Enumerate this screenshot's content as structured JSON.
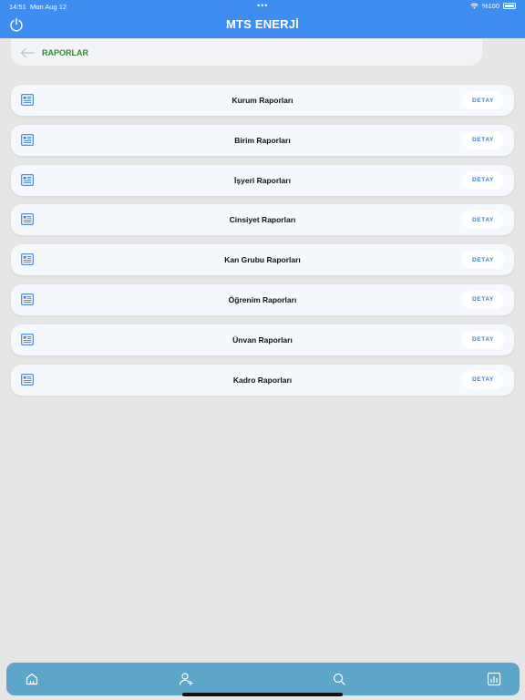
{
  "status_bar": {
    "time": "14:51",
    "date": "Mon Aug 12",
    "dots": "•••",
    "battery": "%100"
  },
  "header": {
    "title": "MTS ENERJİ",
    "power_icon": "power-icon",
    "background": "#3d8ef0"
  },
  "back_bar": {
    "title": "RAPORLAR",
    "icon": "back-arrow-icon",
    "title_color": "#2e8b2e"
  },
  "reports": [
    {
      "label": "Kurum Raporları",
      "action": "DETAY"
    },
    {
      "label": "Birim Raporları",
      "action": "DETAY"
    },
    {
      "label": "İşyeri Raporları",
      "action": "DETAY"
    },
    {
      "label": "Cinsiyet Raporları",
      "action": "DETAY"
    },
    {
      "label": "Kan Grubu Raporları",
      "action": "DETAY"
    },
    {
      "label": "Öğrenim Raporları",
      "action": "DETAY"
    },
    {
      "label": "Ünvan Raporları",
      "action": "DETAY"
    },
    {
      "label": "Kadro Raporları",
      "action": "DETAY"
    }
  ],
  "tab_bar": {
    "background": "#5da5c9",
    "tabs": [
      {
        "icon": "home-icon"
      },
      {
        "icon": "add-user-icon"
      },
      {
        "icon": "search-icon"
      },
      {
        "icon": "report-chart-icon"
      }
    ]
  }
}
